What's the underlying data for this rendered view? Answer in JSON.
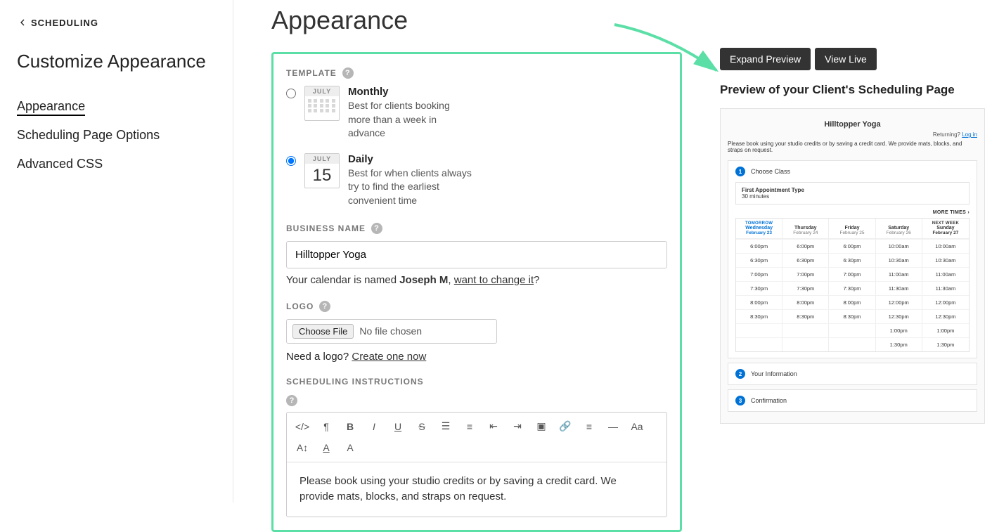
{
  "sidebar": {
    "back_label": "SCHEDULING",
    "heading": "Customize Appearance",
    "nav": [
      {
        "label": "Appearance",
        "active": true
      },
      {
        "label": "Scheduling Page Options",
        "active": false
      },
      {
        "label": "Advanced CSS",
        "active": false
      }
    ]
  },
  "page_title": "Appearance",
  "template": {
    "label": "TEMPLATE",
    "options": [
      {
        "id": "monthly",
        "title": "Monthly",
        "desc": "Best for clients booking more than a week in advance",
        "month": "JULY",
        "selected": false
      },
      {
        "id": "daily",
        "title": "Daily",
        "desc": "Best for when clients always try to find the earliest convenient time",
        "month": "JULY",
        "day": "15",
        "selected": true
      }
    ]
  },
  "business": {
    "label": "BUSINESS NAME",
    "value": "Hilltopper Yoga",
    "named_prefix": "Your calendar is named ",
    "named_name": "Joseph M",
    "named_suffix": ", ",
    "change_link": "want to change it",
    "question": "?"
  },
  "logo": {
    "label": "LOGO",
    "choose_btn": "Choose File",
    "no_file": "No file chosen",
    "need_prefix": "Need a logo? ",
    "create_link": "Create one now"
  },
  "instructions": {
    "label": "SCHEDULING INSTRUCTIONS",
    "body": "Please book using your studio credits or by saving a credit card. We provide mats, blocks, and straps on request."
  },
  "preview": {
    "expand_btn": "Expand Preview",
    "view_live_btn": "View Live",
    "heading": "Preview of your Client's Scheduling Page",
    "biz_name": "Hilltopper Yoga",
    "returning": "Returning? ",
    "login": "Log in",
    "instr": "Please book using your studio credits or by saving a credit card. We provide mats, blocks, and straps on request.",
    "steps": [
      {
        "num": "1",
        "label": "Choose Class"
      },
      {
        "num": "2",
        "label": "Your Information"
      },
      {
        "num": "3",
        "label": "Confirmation"
      }
    ],
    "appt_name": "First Appointment Type",
    "appt_dur": "30 minutes",
    "more_times": "MORE TIMES ›",
    "days": [
      {
        "tag": "TOMORROW",
        "dow": "Wednesday",
        "date": "February 23",
        "cls": "today"
      },
      {
        "tag": "",
        "dow": "Thursday",
        "date": "February 24",
        "cls": ""
      },
      {
        "tag": "",
        "dow": "Friday",
        "date": "February 25",
        "cls": ""
      },
      {
        "tag": "",
        "dow": "Saturday",
        "date": "February 26",
        "cls": ""
      },
      {
        "tag": "NEXT WEEK",
        "dow": "Sunday",
        "date": "February 27",
        "cls": "next"
      }
    ],
    "slots": [
      [
        "6:00pm",
        "6:00pm",
        "6:00pm",
        "10:00am",
        "10:00am"
      ],
      [
        "6:30pm",
        "6:30pm",
        "6:30pm",
        "10:30am",
        "10:30am"
      ],
      [
        "7:00pm",
        "7:00pm",
        "7:00pm",
        "11:00am",
        "11:00am"
      ],
      [
        "7:30pm",
        "7:30pm",
        "7:30pm",
        "11:30am",
        "11:30am"
      ],
      [
        "8:00pm",
        "8:00pm",
        "8:00pm",
        "12:00pm",
        "12:00pm"
      ],
      [
        "8:30pm",
        "8:30pm",
        "8:30pm",
        "12:30pm",
        "12:30pm"
      ],
      [
        "",
        "",
        "",
        "1:00pm",
        "1:00pm"
      ],
      [
        "",
        "",
        "",
        "1:30pm",
        "1:30pm"
      ]
    ]
  }
}
